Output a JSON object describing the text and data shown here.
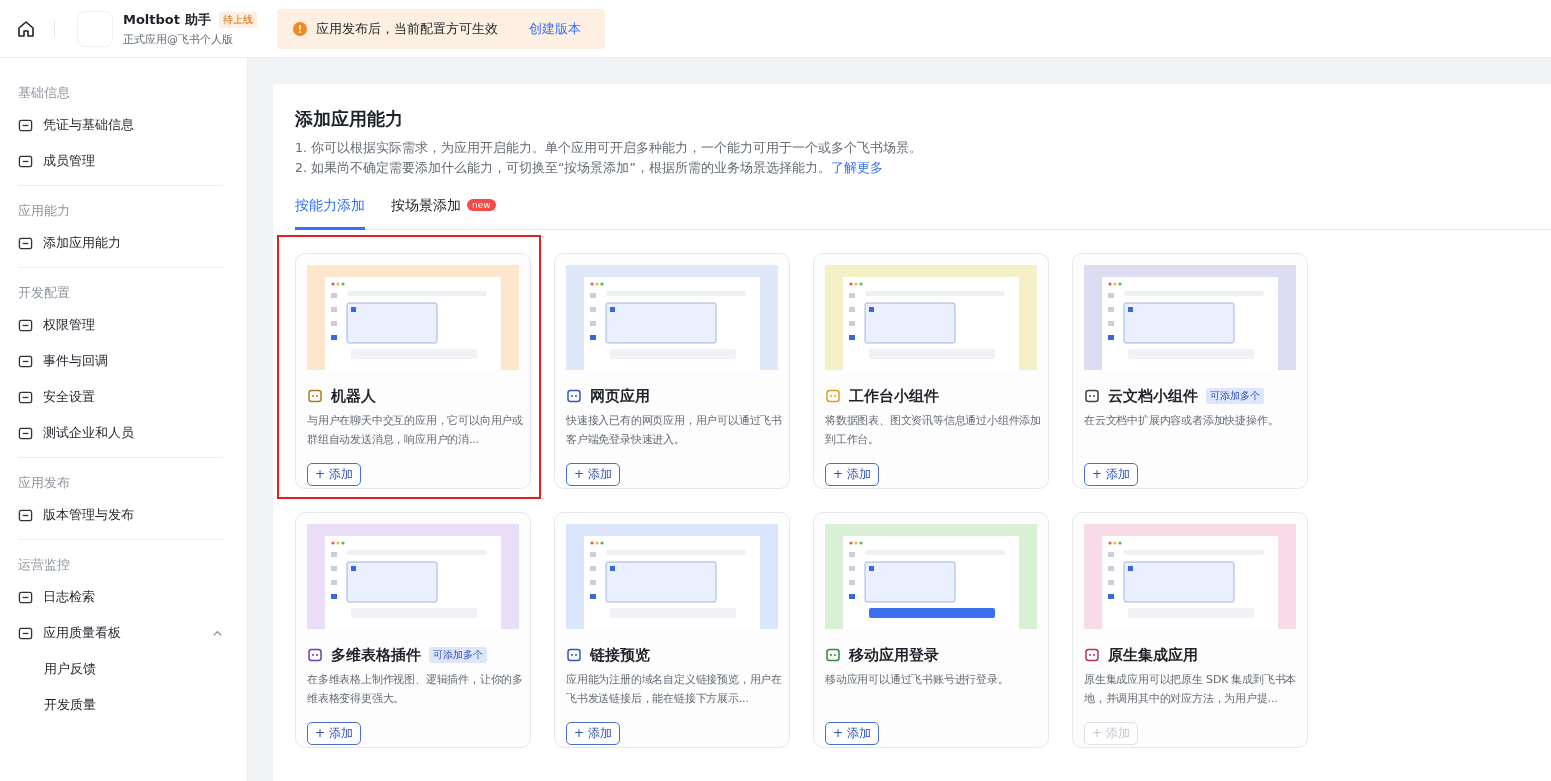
{
  "topbar": {
    "app_name": "Moltbot 助手",
    "status_badge": "待上线",
    "subtitle": "正式应用@飞书个人版",
    "notice": {
      "text": "应用发布后，当前配置方可生效",
      "link": "创建版本"
    }
  },
  "sidebar": {
    "sections": [
      {
        "title": "基础信息",
        "items": [
          {
            "label": "凭证与基础信息"
          },
          {
            "label": "成员管理"
          }
        ]
      },
      {
        "title": "应用能力",
        "items": [
          {
            "label": "添加应用能力"
          }
        ]
      },
      {
        "title": "开发配置",
        "items": [
          {
            "label": "权限管理"
          },
          {
            "label": "事件与回调"
          },
          {
            "label": "安全设置"
          },
          {
            "label": "测试企业和人员"
          }
        ]
      },
      {
        "title": "应用发布",
        "items": [
          {
            "label": "版本管理与发布"
          }
        ]
      },
      {
        "title": "运营监控",
        "items": [
          {
            "label": "日志检索"
          },
          {
            "label": "应用质量看板",
            "expanded": true,
            "children": [
              {
                "label": "用户反馈"
              },
              {
                "label": "开发质量"
              }
            ]
          }
        ]
      }
    ]
  },
  "main": {
    "title": "添加应用能力",
    "lines": [
      "1. 你可以根据实际需求，为应用开启能力。单个应用可开启多种能力，一个能力可用于一个或多个飞书场景。",
      "2. 如果尚不确定需要添加什么能力，可切换至“按场景添加”，根据所需的业务场景选择能力。"
    ],
    "learn_more": "了解更多",
    "tabs": [
      {
        "label": "按能力添加",
        "selected": true
      },
      {
        "label": "按场景添加",
        "selected": false,
        "badge": "new"
      }
    ],
    "cards": [
      {
        "title": "机器人",
        "description": "与用户在聊天中交互的应用，它可以向用户或群组自动发送消息，响应用户的消...",
        "button": "+ 添加",
        "disabled": false,
        "highlighted": true
      },
      {
        "title": "网页应用",
        "description": "快速接入已有的网页应用，用户可以通过飞书客户端免登录快速进入。",
        "button": "+ 添加",
        "disabled": false,
        "highlighted": false
      },
      {
        "title": "工作台小组件",
        "description": "将数据图表、图文资讯等信息通过小组件添加到工作台。",
        "button": "+ 添加",
        "disabled": false,
        "highlighted": false
      },
      {
        "title": "云文档小组件",
        "badge": "可添加多个",
        "description": "在云文档中扩展内容或者添加快捷操作。",
        "button": "+ 添加",
        "disabled": false,
        "highlighted": false
      },
      {
        "title": "多维表格插件",
        "badge": "可添加多个",
        "description": "在多维表格上制作视图、逻辑插件，让你的多维表格变得更强大。",
        "button": "+ 添加",
        "disabled": false,
        "highlighted": false
      },
      {
        "title": "链接预览",
        "description": "应用能为注册的域名自定义链接预览，用户在飞书发送链接后，能在链接下方展示...",
        "button": "+ 添加",
        "disabled": false,
        "highlighted": false
      },
      {
        "title": "移动应用登录",
        "description": "移动应用可以通过飞书账号进行登录。",
        "button": "+ 添加",
        "disabled": false,
        "highlighted": false
      },
      {
        "title": "原生集成应用",
        "description": "原生集成应用可以把原生 SDK 集成到飞书本地，并调用其中的对应方法，为用户提...",
        "button": "+ 添加",
        "disabled": true,
        "highlighted": false
      }
    ]
  }
}
